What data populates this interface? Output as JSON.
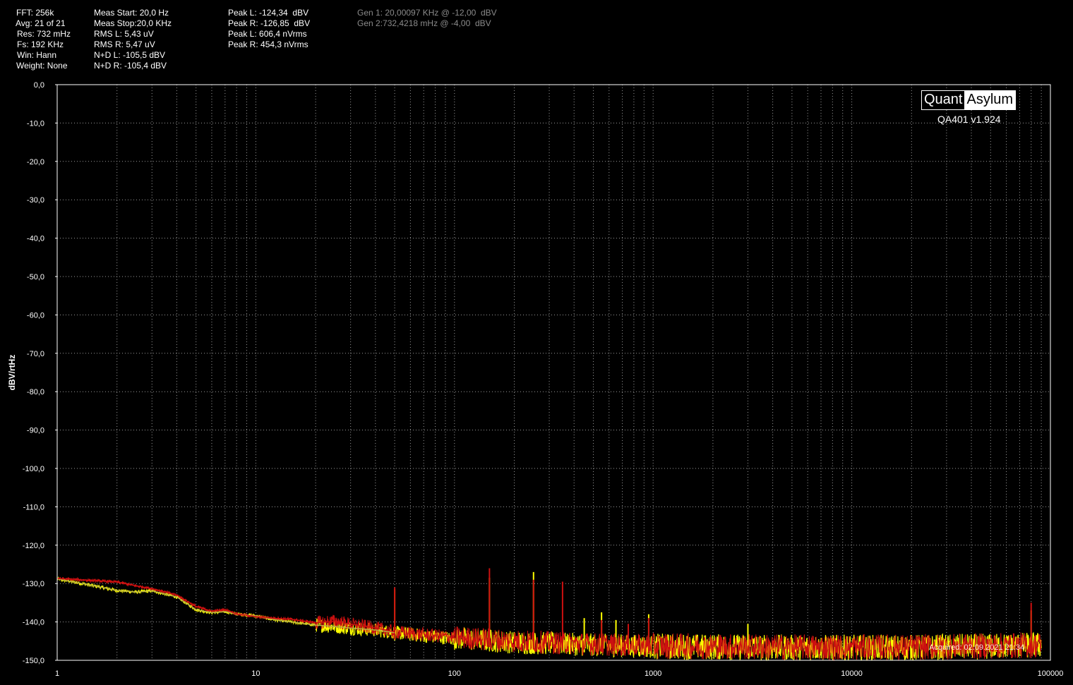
{
  "stats": {
    "col1": [
      "FFT: 256k",
      "Avg: 21 of 21",
      "Res: 732 mHz",
      "Fs: 192 KHz",
      "Win: Hann",
      "Weight: None"
    ],
    "col2": [
      "Meas Start: 20,0 Hz",
      "Meas Stop:20,0 KHz",
      "RMS L: 5,43 uV",
      "RMS R: 5,47 uV",
      "N+D L: -105,5 dBV",
      "N+D R: -105,4 dBV"
    ],
    "col3": [
      "Peak L: -124,34  dBV",
      "Peak R: -126,85  dBV",
      "Peak L: 606,4 nVrms",
      "Peak R: 454,3 nVrms"
    ],
    "gen": [
      "Gen 1: 20,00097 KHz @ -12,00  dBV",
      "Gen 2:732,4218 mHz @ -4,00  dBV"
    ]
  },
  "branding": {
    "logo_left": "Quant",
    "logo_right": "Asylum",
    "version": "QA401 v1.924",
    "acquired": "Acquired: 02.09.2021  21:34"
  },
  "colors": {
    "background": "#000000",
    "grid": "#9a9a9a",
    "left_channel": "#cc1010",
    "right_channel": "#ffff00",
    "right_channel_low": "#b8b040"
  },
  "chart_data": {
    "type": "line",
    "ylabel": "dBV/rtHz",
    "xscale": "log",
    "xlim": [
      1,
      100000
    ],
    "ylim": [
      -150,
      0
    ],
    "x_ticks": [
      1,
      10,
      100,
      1000,
      10000,
      100000
    ],
    "x_tick_labels": [
      "1",
      "10",
      "100",
      "1000",
      "10000",
      "100000"
    ],
    "y_ticks": [
      0,
      -10,
      -20,
      -30,
      -40,
      -50,
      -60,
      -70,
      -80,
      -90,
      -100,
      -110,
      -120,
      -130,
      -140,
      -150
    ],
    "y_tick_labels": [
      "0,0",
      "-10,0",
      "-20,0",
      "-30,0",
      "-40,0",
      "-50,0",
      "-60,0",
      "-70,0",
      "-80,0",
      "-90,0",
      "-100,0",
      "-110,0",
      "-120,0",
      "-130,0",
      "-140,0",
      "-150,0"
    ],
    "grid": true,
    "series": [
      {
        "color": "#cc1010",
        "floor": [
          [
            1,
            -128.7
          ],
          [
            1.5,
            -129.2
          ],
          [
            2,
            -129.6
          ],
          [
            2.5,
            -130.6
          ],
          [
            3,
            -131.3
          ],
          [
            4,
            -133.0
          ],
          [
            5,
            -136.0
          ],
          [
            6,
            -137.2
          ],
          [
            7,
            -136.8
          ],
          [
            8,
            -137.9
          ],
          [
            10,
            -138.6
          ],
          [
            12,
            -139.0
          ],
          [
            15,
            -139.3
          ],
          [
            20,
            -140.2
          ],
          [
            25,
            -139.8
          ],
          [
            30,
            -140.6
          ],
          [
            40,
            -141.6
          ],
          [
            50,
            -142.6
          ],
          [
            70,
            -143.3
          ],
          [
            100,
            -144.0
          ],
          [
            200,
            -145.0
          ],
          [
            500,
            -145.8
          ],
          [
            1000,
            -146.2
          ],
          [
            5000,
            -146.6
          ],
          [
            20000,
            -146.6
          ],
          [
            60000,
            -146.2
          ],
          [
            90000,
            -146.0
          ]
        ],
        "spikes": [
          [
            50,
            -131.0
          ],
          [
            150,
            -126.0
          ],
          [
            250,
            -129.0
          ],
          [
            350,
            -129.5
          ],
          [
            550,
            -139.5
          ],
          [
            750,
            -140.5
          ],
          [
            950,
            -139.0
          ],
          [
            80000,
            -135.0
          ]
        ]
      },
      {
        "color": "#ffff00",
        "floor": [
          [
            1,
            -128.8
          ],
          [
            1.5,
            -130.5
          ],
          [
            2,
            -131.8
          ],
          [
            2.5,
            -132.2
          ],
          [
            3,
            -131.9
          ],
          [
            4,
            -133.5
          ],
          [
            5,
            -136.8
          ],
          [
            6,
            -137.6
          ],
          [
            7,
            -137.3
          ],
          [
            8,
            -137.9
          ],
          [
            10,
            -138.4
          ],
          [
            12,
            -139.3
          ],
          [
            15,
            -140.0
          ],
          [
            20,
            -140.8
          ],
          [
            25,
            -141.2
          ],
          [
            30,
            -141.6
          ],
          [
            40,
            -142.1
          ],
          [
            50,
            -142.8
          ],
          [
            70,
            -143.6
          ],
          [
            100,
            -144.3
          ],
          [
            200,
            -145.3
          ],
          [
            500,
            -146.0
          ],
          [
            1000,
            -146.4
          ],
          [
            5000,
            -146.7
          ],
          [
            20000,
            -146.7
          ],
          [
            60000,
            -146.3
          ],
          [
            90000,
            -146.0
          ]
        ],
        "spikes": [
          [
            50,
            -131.5
          ],
          [
            150,
            -128.5
          ],
          [
            250,
            -127.0
          ],
          [
            450,
            -139.0
          ],
          [
            550,
            -137.5
          ],
          [
            650,
            -139.5
          ],
          [
            950,
            -138.0
          ],
          [
            3000,
            -140.5
          ],
          [
            80000,
            -137.0
          ]
        ]
      }
    ]
  }
}
